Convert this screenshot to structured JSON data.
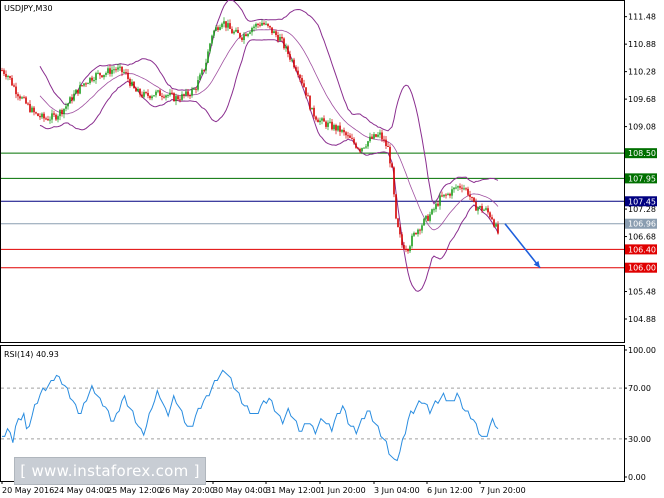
{
  "chart_data": [
    {
      "type": "candlestick",
      "title": "USDJPY,M30",
      "y_ticks": [
        "111.48",
        "110.88",
        "110.28",
        "109.68",
        "109.08",
        "108.50",
        "107.95",
        "107.45",
        "107.28",
        "106.96",
        "106.68",
        "106.40",
        "106.00",
        "105.48",
        "104.88"
      ],
      "tick_values": [
        111.48,
        110.88,
        110.28,
        109.68,
        109.08,
        107.28,
        106.68,
        105.48,
        104.88
      ],
      "ylim": [
        104.4,
        111.8
      ],
      "x_labels": [
        "20 May 2016",
        "24 May 04:00",
        "25 May 12:00",
        "26 May 20:00",
        "30 May 04:00",
        "31 May 12:00",
        "1 Jun 20:00",
        "3 Jun 04:00",
        "6 Jun 12:00",
        "7 Jun 20:00"
      ],
      "levels": [
        {
          "value": 108.5,
          "label": "108.50",
          "color": "#007000"
        },
        {
          "value": 107.95,
          "label": "107.95",
          "color": "#007000"
        },
        {
          "value": 107.45,
          "label": "107.45",
          "color": "#000080"
        },
        {
          "value": 106.96,
          "label": "106.96",
          "color": "#8a9db0"
        },
        {
          "value": 106.4,
          "label": "106.40",
          "color": "#e00000"
        },
        {
          "value": 106.0,
          "label": "106.00",
          "color": "#e00000"
        }
      ],
      "price_path": [
        [
          0,
          110.35
        ],
        [
          8,
          110.2
        ],
        [
          15,
          109.9
        ],
        [
          25,
          109.6
        ],
        [
          35,
          109.35
        ],
        [
          45,
          109.25
        ],
        [
          55,
          109.3
        ],
        [
          65,
          109.5
        ],
        [
          75,
          109.8
        ],
        [
          85,
          110.05
        ],
        [
          95,
          110.2
        ],
        [
          105,
          110.25
        ],
        [
          115,
          110.35
        ],
        [
          125,
          110.25
        ],
        [
          135,
          109.85
        ],
        [
          145,
          109.75
        ],
        [
          155,
          109.8
        ],
        [
          165,
          109.8
        ],
        [
          175,
          109.7
        ],
        [
          185,
          109.75
        ],
        [
          195,
          109.9
        ],
        [
          205,
          110.4
        ],
        [
          212,
          111.1
        ],
        [
          222,
          111.4
        ],
        [
          232,
          111.15
        ],
        [
          242,
          111.05
        ],
        [
          252,
          111.25
        ],
        [
          262,
          111.35
        ],
        [
          270,
          111.2
        ],
        [
          280,
          111.0
        ],
        [
          290,
          110.6
        ],
        [
          298,
          110.3
        ],
        [
          305,
          109.9
        ],
        [
          312,
          109.4
        ],
        [
          320,
          109.2
        ],
        [
          330,
          109.1
        ],
        [
          340,
          109.0
        ],
        [
          350,
          108.8
        ],
        [
          360,
          108.6
        ],
        [
          370,
          108.8
        ],
        [
          380,
          108.9
        ],
        [
          388,
          108.6
        ],
        [
          392,
          108.1
        ],
        [
          396,
          107.0
        ],
        [
          402,
          106.5
        ],
        [
          408,
          106.45
        ],
        [
          416,
          106.8
        ],
        [
          424,
          107.0
        ],
        [
          432,
          107.2
        ],
        [
          440,
          107.5
        ],
        [
          448,
          107.6
        ],
        [
          456,
          107.75
        ],
        [
          462,
          107.8
        ],
        [
          468,
          107.65
        ],
        [
          474,
          107.35
        ],
        [
          480,
          107.3
        ],
        [
          486,
          107.25
        ],
        [
          492,
          107.1
        ],
        [
          498,
          106.75
        ]
      ],
      "forecast_arrow": {
        "from": [
          505,
          106.96
        ],
        "to": [
          540,
          106.0
        ],
        "color": "#1e5fdc"
      }
    },
    {
      "type": "line",
      "title": "RSI(14) 40.93",
      "ylim": [
        0,
        100
      ],
      "y_ticks": [
        "100.00",
        "70.00",
        "30.00",
        "0.00"
      ],
      "tick_values": [
        100,
        70,
        30,
        0
      ],
      "levels": [
        70,
        30
      ],
      "color": "#2a8de0",
      "values": [
        30,
        34,
        38,
        33,
        29,
        40,
        44,
        47,
        50,
        36,
        42,
        48,
        55,
        60,
        65,
        68,
        70,
        72,
        74,
        78,
        80,
        77,
        75,
        72,
        68,
        64,
        60,
        55,
        52,
        50,
        56,
        62,
        66,
        70,
        68,
        64,
        60,
        58,
        55,
        50,
        46,
        44,
        48,
        54,
        60,
        62,
        58,
        54,
        50,
        45,
        40,
        36,
        35,
        40,
        48,
        56,
        60,
        66,
        64,
        58,
        52,
        50,
        56,
        62,
        60,
        55,
        50,
        45,
        40,
        38,
        42,
        48,
        52,
        56,
        60,
        62,
        66,
        70,
        74,
        78,
        80,
        82,
        84,
        80,
        76,
        72,
        68,
        64,
        60,
        56,
        54,
        52,
        50,
        48,
        52,
        56,
        58,
        60,
        62,
        58,
        54,
        50,
        46,
        44,
        48,
        52,
        50,
        46,
        42,
        38,
        36,
        40,
        44,
        42,
        38,
        36,
        40,
        44,
        46,
        42,
        40,
        38,
        44,
        48,
        52,
        56,
        50,
        44,
        40,
        38,
        36,
        40,
        44,
        48,
        52,
        50,
        46,
        42,
        38,
        34,
        30,
        26,
        20,
        16,
        12,
        15,
        20,
        28,
        36,
        45,
        50,
        52,
        55,
        58,
        60,
        58,
        55,
        52,
        55,
        58,
        60,
        62,
        64,
        62,
        60,
        58,
        62,
        66,
        60,
        56,
        52,
        50,
        48,
        45,
        40,
        36,
        32,
        30,
        34,
        40,
        44,
        42,
        38
      ]
    }
  ],
  "watermark": {
    "text": "[  www.instaforex.com  ]"
  },
  "colors": {
    "bull": "#1a9c1a",
    "bear": "#d40000",
    "bands": "#8a2e8f",
    "band_mid": "#a050a0"
  }
}
